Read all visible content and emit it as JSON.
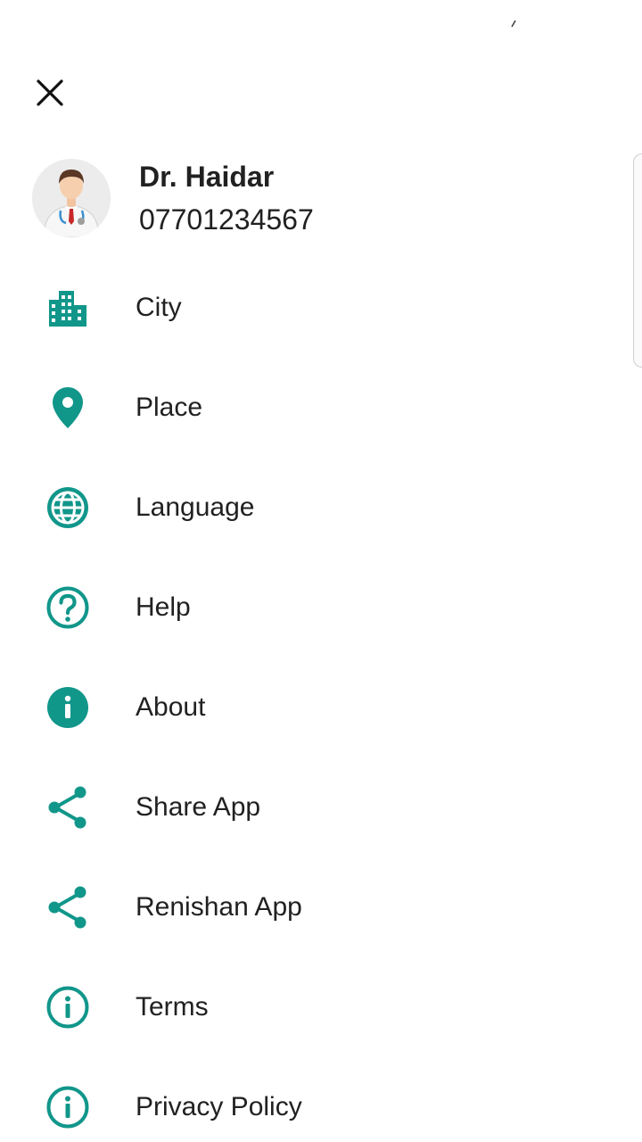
{
  "colors": {
    "accent": "#11968a",
    "text": "#212121",
    "background": "#ffffff"
  },
  "drawer": {
    "close_icon": "close-icon",
    "profile": {
      "name": "Dr. Haidar",
      "phone": "07701234567",
      "avatar_icon": "doctor-avatar"
    },
    "menu": [
      {
        "id": "city",
        "label": "City",
        "icon": "city-icon"
      },
      {
        "id": "place",
        "label": "Place",
        "icon": "location-pin-icon"
      },
      {
        "id": "language",
        "label": "Language",
        "icon": "globe-icon"
      },
      {
        "id": "help",
        "label": "Help",
        "icon": "help-circle-icon"
      },
      {
        "id": "about",
        "label": "About",
        "icon": "info-filled-icon"
      },
      {
        "id": "share-app",
        "label": "Share App",
        "icon": "share-icon"
      },
      {
        "id": "renishan-app",
        "label": "Renishan App",
        "icon": "share-icon"
      },
      {
        "id": "terms",
        "label": "Terms",
        "icon": "info-outline-icon"
      },
      {
        "id": "privacy-policy",
        "label": "Privacy Policy",
        "icon": "info-outline-icon"
      }
    ]
  }
}
